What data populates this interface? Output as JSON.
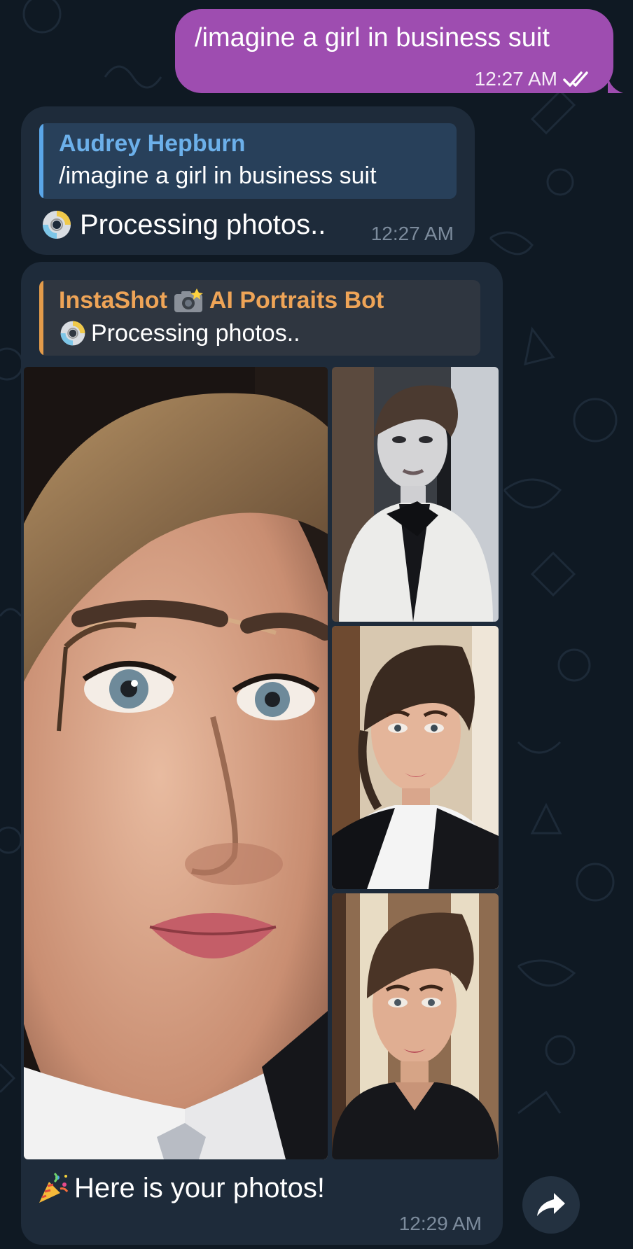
{
  "outgoing": {
    "text": "/imagine a girl in business suit",
    "time": "12:27 AM",
    "status_icon": "double-check-icon"
  },
  "incoming_1": {
    "reply": {
      "name": "Audrey Hepburn",
      "text": "/imagine a girl in business suit"
    },
    "body_text": "Processing photos..",
    "body_icon": "dvd-icon",
    "time": "12:27 AM"
  },
  "incoming_2": {
    "reply": {
      "name_prefix": "InstaShot",
      "name_icon": "camera-flash-icon",
      "name_suffix": "AI Portraits Bot",
      "text": "Processing photos..",
      "text_icon": "dvd-icon"
    },
    "photos": [
      "portrait-closeup",
      "portrait-white-blazer",
      "portrait-black-white-suit",
      "portrait-black-blazer"
    ],
    "caption": "Here is your photos!",
    "caption_icon": "party-popper-icon",
    "time": "12:29 AM"
  },
  "share_icon": "share-arrow-icon",
  "colors": {
    "background": "#0f1923",
    "outgoing_bubble": "#9e4db0",
    "incoming_bubble": "#1e2b3a",
    "reply_blue": "#5aa6e8",
    "reply_orange": "#e39b4a",
    "time_gray": "#7c8b9c"
  }
}
